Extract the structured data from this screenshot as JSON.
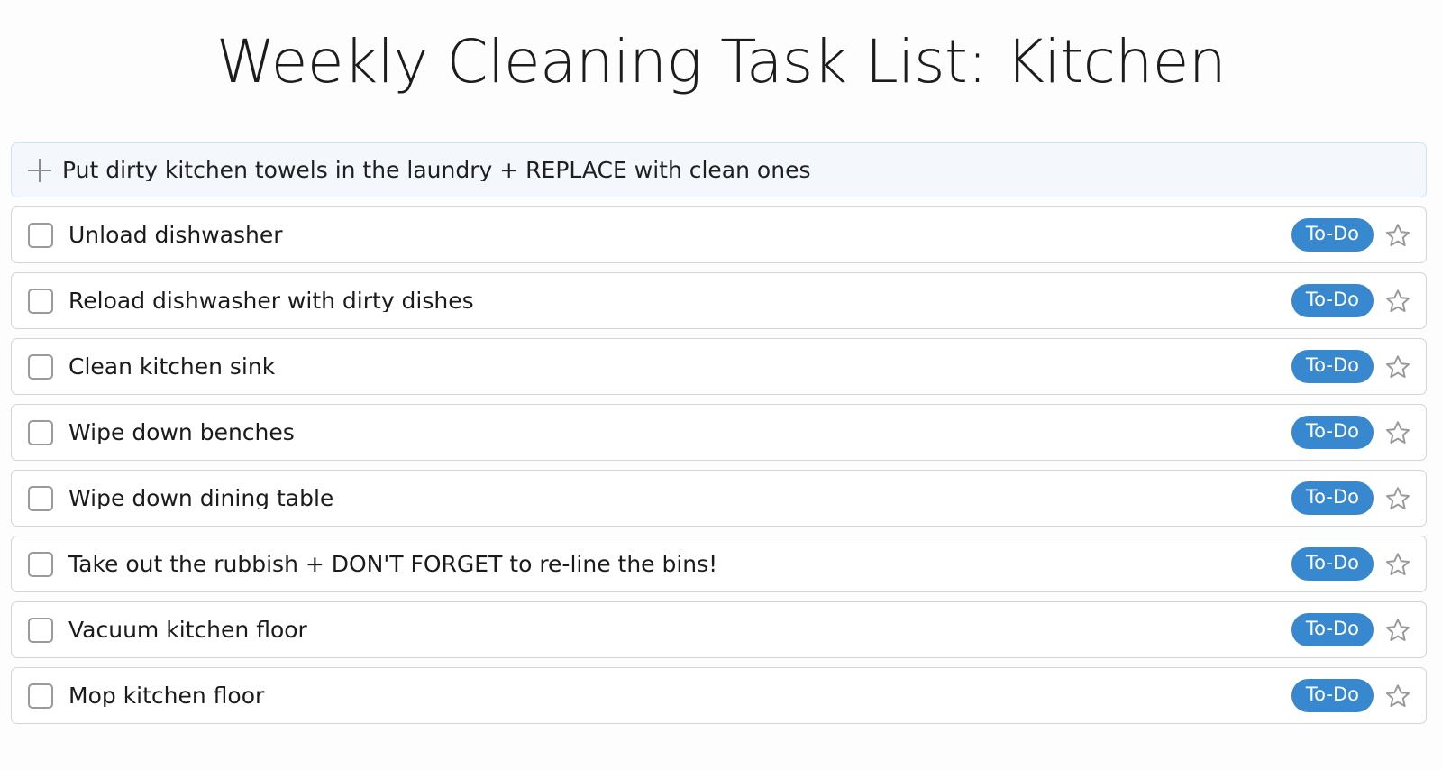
{
  "page": {
    "title": "Weekly Cleaning Task List: Kitchen"
  },
  "compose": {
    "icon": "plus-icon",
    "value": "Put dirty kitchen towels in the laundry + REPLACE with clean ones",
    "placeholder": "Put dirty kitchen towels in the laundry + REPLACE with clean ones"
  },
  "colors": {
    "page_background": "#fdfdfd",
    "badge_blue": "#3788ce",
    "badge_text": "#ffffff",
    "row_border": "#d4d4d4",
    "compose_border": "#cfe3f7",
    "compose_background": "#f4f8fd",
    "star_stroke": "#9a9a9a",
    "title_text": "#1c1c1c"
  },
  "tasks": [
    {
      "label": "Unload dishwasher",
      "status": "To-Do",
      "checked": false,
      "starred": false
    },
    {
      "label": "Reload dishwasher with dirty dishes",
      "status": "To-Do",
      "checked": false,
      "starred": false
    },
    {
      "label": "Clean kitchen sink",
      "status": "To-Do",
      "checked": false,
      "starred": false
    },
    {
      "label": "Wipe down benches",
      "status": "To-Do",
      "checked": false,
      "starred": false
    },
    {
      "label": "Wipe down dining table",
      "status": "To-Do",
      "checked": false,
      "starred": false
    },
    {
      "label": "Take out the rubbish + DON'T FORGET to re-line the bins!",
      "status": "To-Do",
      "checked": false,
      "starred": false
    },
    {
      "label": "Vacuum kitchen floor",
      "status": "To-Do",
      "checked": false,
      "starred": false
    },
    {
      "label": "Mop kitchen floor",
      "status": "To-Do",
      "checked": false,
      "starred": false
    }
  ]
}
